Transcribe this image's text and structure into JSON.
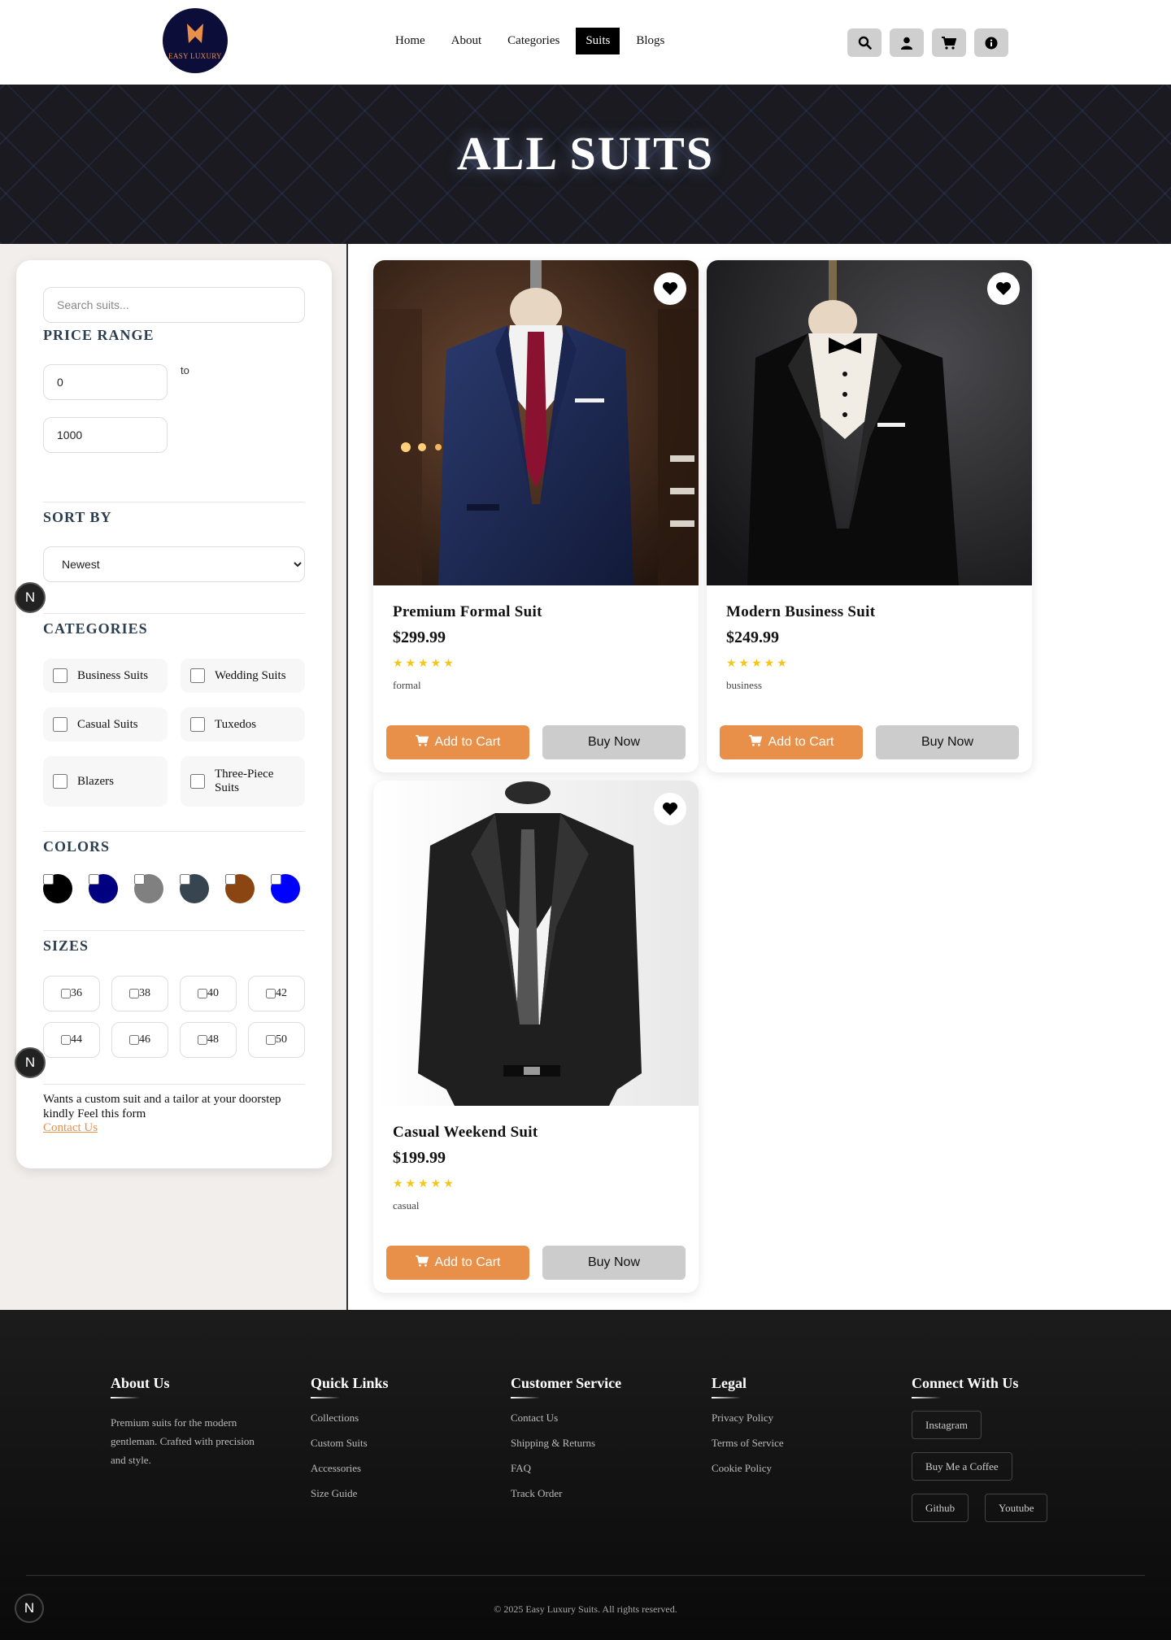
{
  "brand": {
    "logo_text": "EASY LUXURY"
  },
  "nav": {
    "links": [
      "Home",
      "About",
      "Categories",
      "Suits",
      "Blogs"
    ],
    "active": "Suits"
  },
  "hero": {
    "title": "ALL SUITS"
  },
  "filters": {
    "search_placeholder": "Search suits...",
    "price_range": {
      "title": "PRICE RANGE",
      "min": "0",
      "max": "1000",
      "to_label": "to"
    },
    "sort": {
      "title": "SORT BY",
      "selected": "Newest"
    },
    "categories": {
      "title": "CATEGORIES",
      "items": [
        "Business Suits",
        "Wedding Suits",
        "Casual Suits",
        "Tuxedos",
        "Blazers",
        "Three-Piece Suits"
      ]
    },
    "colors": {
      "title": "COLORS",
      "swatches": [
        "#000000",
        "#000080",
        "#808080",
        "#36454f",
        "#8b4513",
        "#0000ff"
      ]
    },
    "sizes": {
      "title": "SIZES",
      "items": [
        "36",
        "38",
        "40",
        "42",
        "44",
        "46",
        "48",
        "50"
      ]
    },
    "custom": {
      "text": "Wants a custom suit and a tailor at your doorstep kindly Feel this form",
      "link": "Contact Us"
    }
  },
  "products": [
    {
      "name": "Premium Formal Suit",
      "price": "$299.99",
      "stars": "★★★★★",
      "tag": "formal",
      "cart_label": "Add to Cart",
      "buy_label": "Buy Now"
    },
    {
      "name": "Modern Business Suit",
      "price": "$249.99",
      "stars": "★★★★★",
      "tag": "business",
      "cart_label": "Add to Cart",
      "buy_label": "Buy Now"
    },
    {
      "name": "Casual Weekend Suit",
      "price": "$199.99",
      "stars": "★★★★★",
      "tag": "casual",
      "cart_label": "Add to Cart",
      "buy_label": "Buy Now"
    }
  ],
  "badge": {
    "letter": "N"
  },
  "footer": {
    "about": {
      "title": "About Us",
      "text": "Premium suits for the modern gentleman. Crafted with precision and style."
    },
    "quick_links": {
      "title": "Quick Links",
      "items": [
        "Collections",
        "Custom Suits",
        "Accessories",
        "Size Guide"
      ]
    },
    "customer_service": {
      "title": "Customer Service",
      "items": [
        "Contact Us",
        "Shipping & Returns",
        "FAQ",
        "Track Order"
      ]
    },
    "legal": {
      "title": "Legal",
      "items": [
        "Privacy Policy",
        "Terms of Service",
        "Cookie Policy"
      ]
    },
    "connect": {
      "title": "Connect With Us",
      "items": [
        "Instagram",
        "Buy Me a Coffee",
        "Github",
        "Youtube"
      ]
    },
    "copyright": "© 2025 Easy Luxury Suits. All rights reserved."
  },
  "colors": {
    "accent": "#e8904a",
    "dark": "#000000",
    "heading": "#2c3e50",
    "star": "#f5c518"
  }
}
